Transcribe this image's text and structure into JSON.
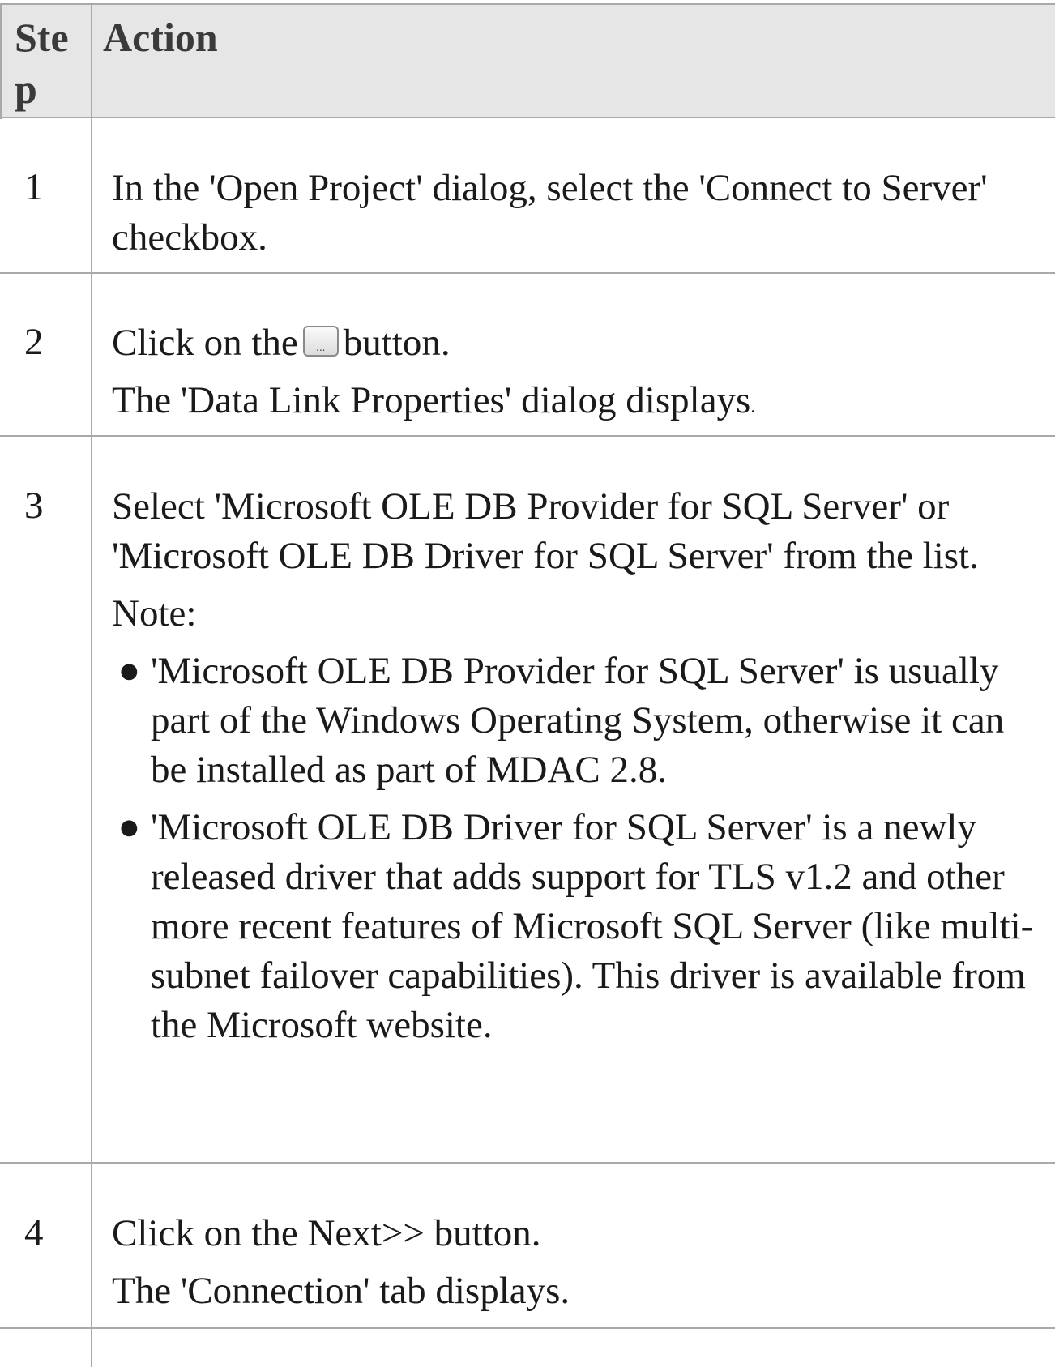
{
  "table": {
    "header": {
      "step": "Ste p",
      "action": "Action"
    },
    "rows": [
      {
        "step": "1",
        "text": "In the 'Open Project' dialog, select the 'Connect to Server' checkbox."
      },
      {
        "step": "2",
        "text_before_icon": "Click on the",
        "icon": "ellipsis-button-icon",
        "icon_glyph": "...",
        "text_after_icon": "button.",
        "result": "The 'Data Link Properties' dialog displays",
        "result_end": "."
      },
      {
        "step": "3",
        "text": "Select 'Microsoft OLE DB Provider for SQL Server' or 'Microsoft OLE DB Driver for SQL Server' from the list.",
        "note_label": "Note:",
        "notes": [
          "'Microsoft OLE DB Provider for SQL Server' is usually part of the Windows Operating System, otherwise it can be installed as part of MDAC 2.8.",
          "'Microsoft OLE DB Driver for SQL Server' is a newly released driver that adds support for TLS v1.2 and other more recent features of Microsoft SQL Server (like multi-subnet failover capabilities). This driver is available from the Microsoft website."
        ]
      },
      {
        "step": "4",
        "text": "Click on the Next>> button.",
        "result": "The 'Connection' tab displays."
      }
    ]
  }
}
